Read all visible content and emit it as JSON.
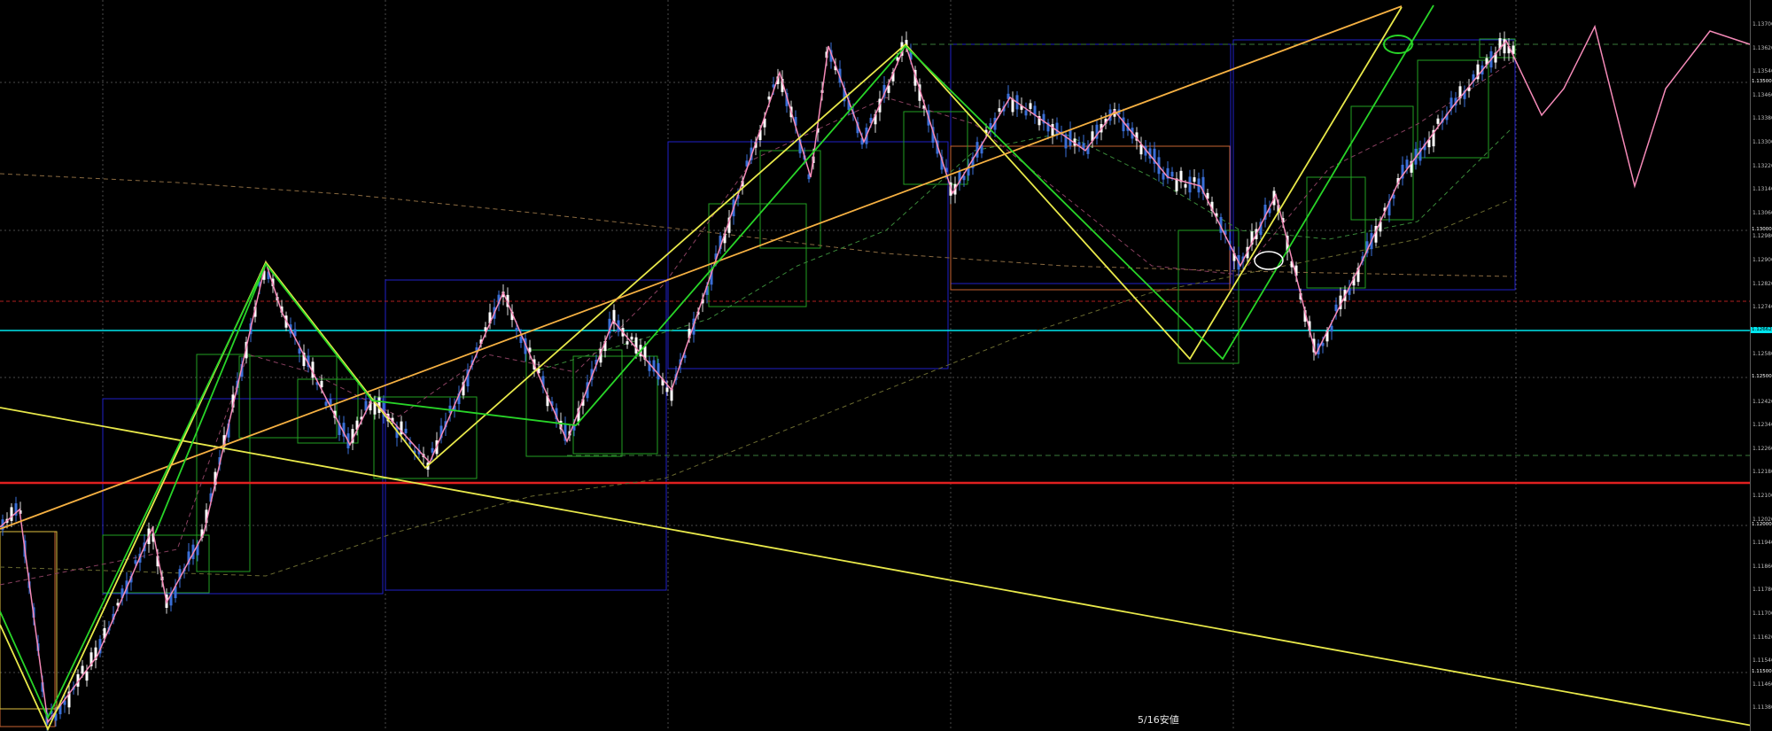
{
  "chart": {
    "date_label": "5/16安値",
    "price_axis_ticks": [
      "1.13700",
      "1.13620",
      "1.13540",
      "1.13460",
      "1.13380",
      "1.13300",
      "1.13220",
      "1.13140",
      "1.13060",
      "1.12980",
      "1.12900",
      "1.12820",
      "1.12740",
      "1.12660",
      "1.12580",
      "1.12500",
      "1.12420",
      "1.12340",
      "1.12260",
      "1.12180",
      "1.12100",
      "1.12020",
      "1.11940",
      "1.11860",
      "1.11780",
      "1.11700",
      "1.11620",
      "1.11540",
      "1.11460",
      "1.11380"
    ],
    "price_tags": [
      {
        "label": "1.13500",
        "color": "#ffffff",
        "bg": "#000000"
      },
      {
        "label": "1.13000",
        "color": "#ffffff",
        "bg": "#000000"
      },
      {
        "label": "1.12662",
        "color": "#000000",
        "bg": "#00e5ee"
      },
      {
        "label": "1.12500",
        "color": "#ffffff",
        "bg": "#000000"
      },
      {
        "label": "1.12000",
        "color": "#ffffff",
        "bg": "#000000"
      },
      {
        "label": "1.11500",
        "color": "#ffffff",
        "bg": "#000000"
      }
    ],
    "colors": {
      "background": "#000000",
      "grid": "#4a4a4a",
      "candle_bull": "#ffffff",
      "candle_bear": "#3a6fd8",
      "support_red": "#e02020",
      "current_price_cyan": "#00e5ee",
      "trend_yellow": "#e8e84a",
      "trend_orange": "#f5b042",
      "channel_green": "#28d428",
      "zigzag_pink": "#f58ab8",
      "box_blue": "#2020c8",
      "box_orange": "#c86432",
      "box_green": "#22a022"
    },
    "icons": [
      "ellipse-marker-icon"
    ]
  }
}
